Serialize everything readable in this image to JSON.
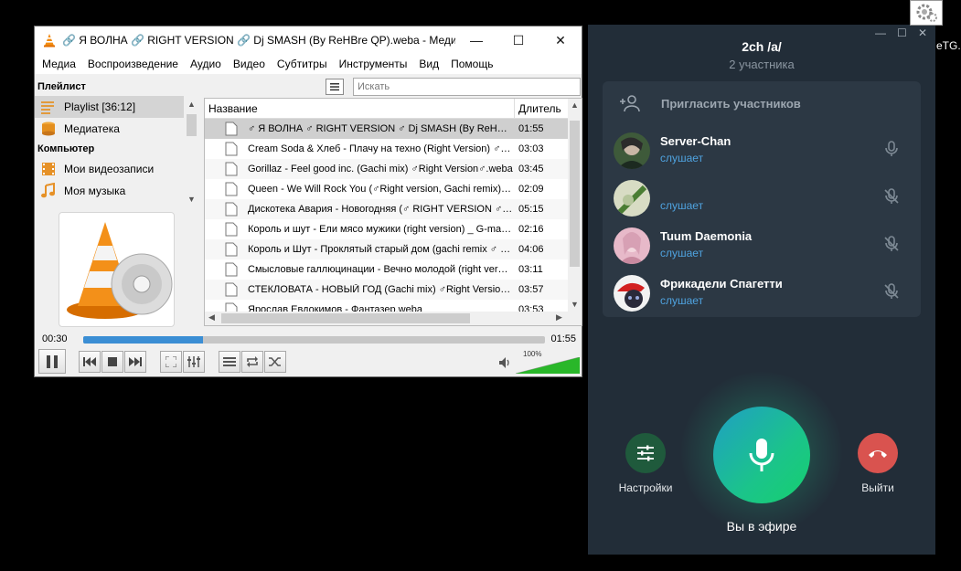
{
  "vlc": {
    "title": "🔗 Я ВОЛНА 🔗 RIGHT VERSION 🔗 Dj SMASH (By ReHBre QP).weba - Медиапро...",
    "menu": [
      "Медиа",
      "Воспроизведение",
      "Аудио",
      "Видео",
      "Субтитры",
      "Инструменты",
      "Вид",
      "Помощь"
    ],
    "sidebar": {
      "section_playlist": "Плейлист",
      "playlist_item": "Playlist [36:12]",
      "library_item": "Медиатека",
      "section_computer": "Компьютер",
      "videos_item": "Мои видеозаписи",
      "music_item": "Моя музыка"
    },
    "search_placeholder": "Искать",
    "columns": {
      "name": "Название",
      "duration": "Длитель"
    },
    "tracks": [
      {
        "name": "♂ Я ВОЛНА ♂ RIGHT VERSION ♂ Dj SMASH (By ReHBre QP).weba",
        "duration": "01:55"
      },
      {
        "name": "Cream Soda & Хлеб - Плачу на техно (Right Version) ♂ Gachi.weba",
        "duration": "03:03"
      },
      {
        "name": "Gorillaz - Feel good inc. (Gachi mix) ♂Right Version♂.weba",
        "duration": "03:45"
      },
      {
        "name": "Queen - We Will Rock You (♂Right version, Gachi remix).weba",
        "duration": "02:09"
      },
      {
        "name": "Дискотека Авария - Новогодняя (♂ RIGHT VERSION ♂ Gachi).weba",
        "duration": "05:15"
      },
      {
        "name": "Король и шут - Ели мясо мужики (right version) _ G-man.weba",
        "duration": "02:16"
      },
      {
        "name": "Король и Шут - Проклятый старый дом (gachi remix ♂ right).weba",
        "duration": "04:06"
      },
      {
        "name": "Смысловые галлюцинации - Вечно молодой (right version).weba",
        "duration": "03:11"
      },
      {
        "name": "СТЕКЛОВАТА - НОВЫЙ ГОД (Gachi mix) ♂Right Version♂.weba",
        "duration": "03:57"
      },
      {
        "name": "Ярослав Евдокимов - Фантазер.weba",
        "duration": "03:53"
      }
    ],
    "time_elapsed": "00:30",
    "time_total": "01:55",
    "progress_fraction": 0.26,
    "volume_label": "100%",
    "volume_fraction": 1.0
  },
  "telegram": {
    "title": "2ch /a/",
    "subtitle": "2 участника",
    "invite_label": "Пригласить участников",
    "members": [
      {
        "name": "Server-Chan",
        "status": "слушает",
        "mic": "on"
      },
      {
        "name": "",
        "status": "слушает",
        "mic": "off"
      },
      {
        "name": "Tuum Daemonia",
        "status": "слушает",
        "mic": "off"
      },
      {
        "name": "Фрикадели Спагетти",
        "status": "слушает",
        "mic": "off"
      }
    ],
    "settings_label": "Настройки",
    "leave_label": "Выйти",
    "on_air_label": "Вы в эфире",
    "colors": {
      "bg": "#222d38",
      "panel": "#2c3844",
      "status": "#4fa3e0",
      "leave": "#d9534f",
      "settings": "#1f5a3c"
    }
  },
  "corner_text": "eTG..."
}
